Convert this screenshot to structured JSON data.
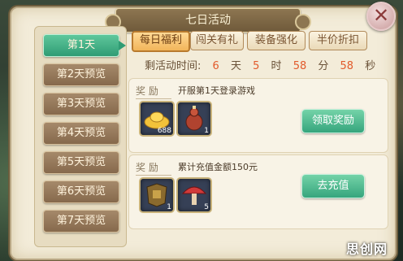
{
  "window": {
    "title": "七日活动",
    "close_glyph": "✕"
  },
  "sidebar": {
    "days": [
      "第1天",
      "第2天预览",
      "第3天预览",
      "第4天预览",
      "第5天预览",
      "第6天预览",
      "第7天预览"
    ]
  },
  "tabs": [
    "每日福利",
    "闯关有礼",
    "装备强化",
    "半价折扣"
  ],
  "timer": {
    "label": "剩活动时间:",
    "days": "6",
    "days_unit": "天",
    "hours": "5",
    "hours_unit": "时",
    "minutes": "58",
    "minutes_unit": "分",
    "seconds": "58",
    "seconds_unit": "秒"
  },
  "rewards": [
    {
      "label": "奖 励",
      "desc": "开服第1天登录游戏",
      "items": [
        {
          "icon": "gold-ingot-icon",
          "count": "688"
        },
        {
          "icon": "potion-gourd-icon",
          "count": "1"
        }
      ],
      "button": "领取奖励"
    },
    {
      "label": "奖 励",
      "desc": "累计充值金额150元",
      "items": [
        {
          "icon": "armor-icon",
          "count": "1"
        },
        {
          "icon": "mushroom-icon",
          "count": "5"
        }
      ],
      "button": "去充值"
    }
  ],
  "watermark": "思创网"
}
